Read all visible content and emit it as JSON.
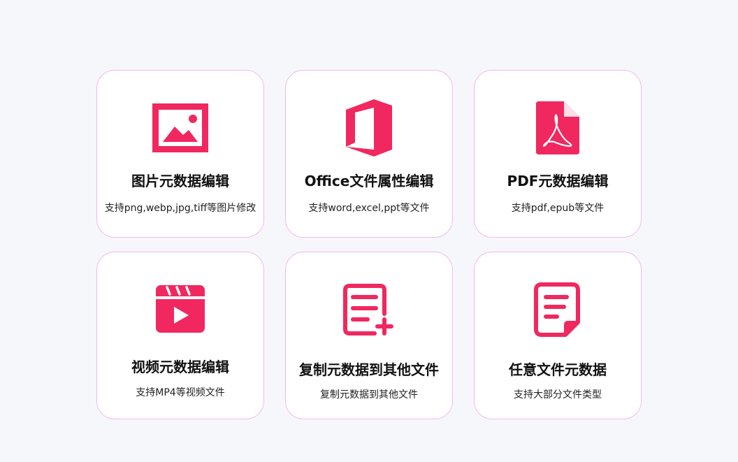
{
  "accent_color": "#f0285f",
  "cards": [
    {
      "icon": "image-icon",
      "title": "图片元数据编辑",
      "description": "支持png,webp,jpg,tiff等图片修改"
    },
    {
      "icon": "office-icon",
      "title": "Office文件属性编辑",
      "description": "支持word,excel,ppt等文件"
    },
    {
      "icon": "pdf-icon",
      "title": "PDF元数据编辑",
      "description": "支持pdf,epub等文件"
    },
    {
      "icon": "video-icon",
      "title": "视频元数据编辑",
      "description": "支持MP4等视频文件"
    },
    {
      "icon": "copy-document-icon",
      "title": "复制元数据到其他文件",
      "description": "复制元数据到其他文件"
    },
    {
      "icon": "document-icon",
      "title": "任意文件元数据",
      "description": "支持大部分文件类型"
    }
  ]
}
